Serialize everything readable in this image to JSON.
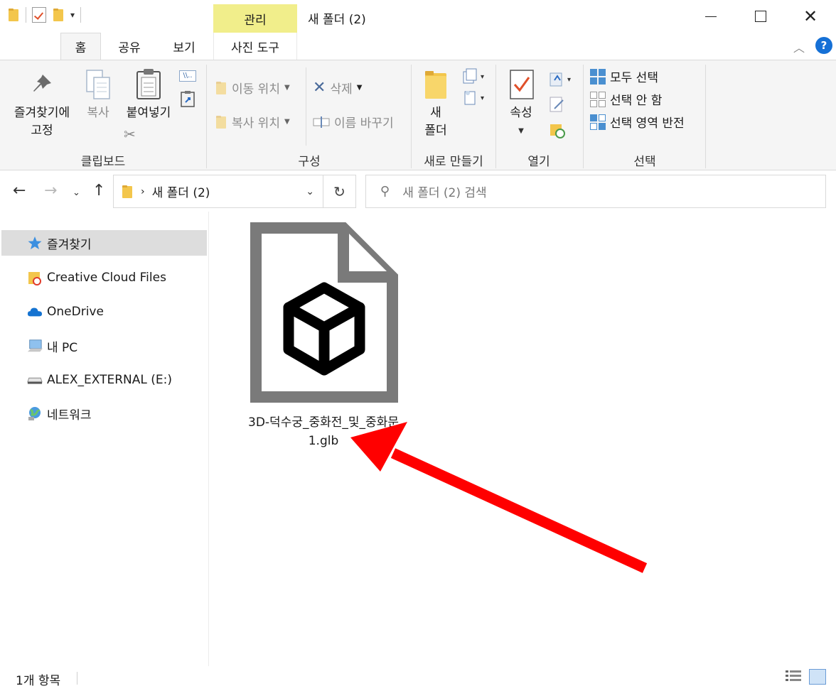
{
  "window": {
    "title": "새 폴더 (2)",
    "contextual_tab_group": "관리"
  },
  "tabs": {
    "home": "홈",
    "share": "공유",
    "view": "보기",
    "picture_tools": "사진 도구"
  },
  "ribbon": {
    "clipboard": {
      "group_label": "클립보드",
      "pin_line1": "즐겨찾기에",
      "pin_line2": "고정",
      "copy": "복사",
      "paste": "붙여넣기"
    },
    "organize": {
      "group_label": "구성",
      "move_to": "이동 위치",
      "copy_to": "복사 위치",
      "delete": "삭제",
      "rename": "이름 바꾸기"
    },
    "new": {
      "group_label": "새로 만들기",
      "new_folder_line1": "새",
      "new_folder_line2": "폴더"
    },
    "open": {
      "group_label": "열기",
      "properties": "속성"
    },
    "select": {
      "group_label": "선택",
      "select_all": "모두 선택",
      "select_none": "선택 안 함",
      "invert_selection": "선택 영역 반전"
    }
  },
  "address_bar": {
    "path_item": "새 폴더 (2)",
    "search_placeholder": "새 폴더 (2) 검색"
  },
  "sidebar": {
    "items": [
      {
        "label": "즐겨찾기",
        "icon": "star-icon"
      },
      {
        "label": "Creative Cloud Files",
        "icon": "creative-cloud-folder-icon"
      },
      {
        "label": "OneDrive",
        "icon": "cloud-icon"
      },
      {
        "label": "내 PC",
        "icon": "computer-icon"
      },
      {
        "label": "ALEX_EXTERNAL (E:)",
        "icon": "drive-icon"
      },
      {
        "label": "네트워크",
        "icon": "network-icon"
      }
    ]
  },
  "files": [
    {
      "name_line1": "3D-덕수궁_중화전_및_중화문",
      "name_line2": "1.glb",
      "icon": "3d-object-file-icon"
    }
  ],
  "status": {
    "item_count": "1개 항목"
  },
  "colors": {
    "contextual_tab": "#f1ee8b",
    "ribbon_bg": "#f5f5f5",
    "selection_bg": "#dddddd",
    "annotation_arrow": "#ff0000",
    "help_button": "#1570d6"
  }
}
